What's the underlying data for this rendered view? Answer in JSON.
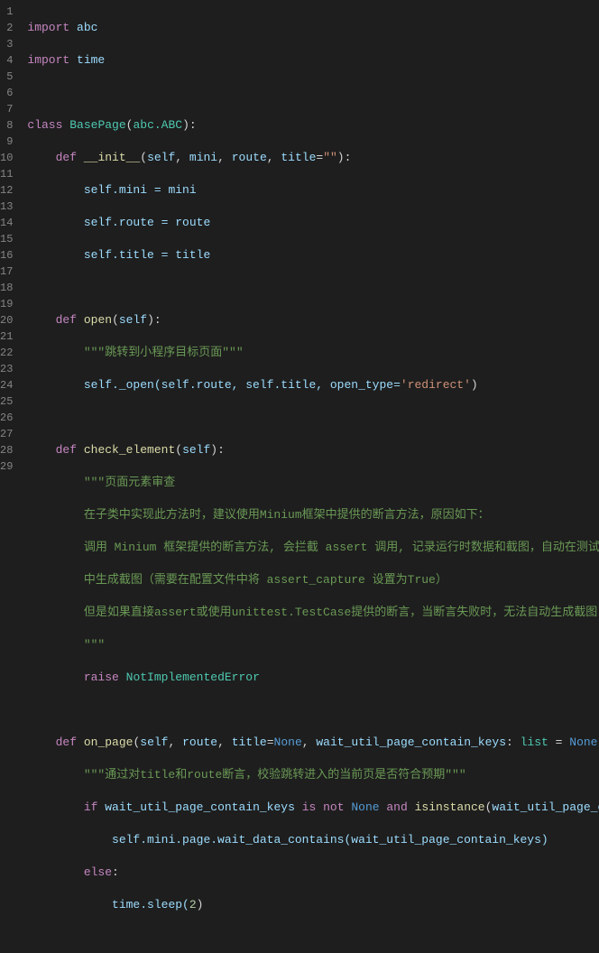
{
  "lines": {
    "l1": {
      "n": "1"
    },
    "l2": {
      "n": "2"
    },
    "l3": {
      "n": "3"
    },
    "l4": {
      "n": "4"
    },
    "l5": {
      "n": "5"
    },
    "l6": {
      "n": "6"
    },
    "l7": {
      "n": "7"
    },
    "l8": {
      "n": "8"
    },
    "l9": {
      "n": "9"
    },
    "l10": {
      "n": "10"
    },
    "l11": {
      "n": "11"
    },
    "l12": {
      "n": "12"
    },
    "l13": {
      "n": "13"
    },
    "l14": {
      "n": "14"
    },
    "l15": {
      "n": "15"
    },
    "l16": {
      "n": "16"
    },
    "l17": {
      "n": "17"
    },
    "l18": {
      "n": "18"
    },
    "l19": {
      "n": "19"
    },
    "l20": {
      "n": "20"
    },
    "l21": {
      "n": "21"
    },
    "l22": {
      "n": "22"
    },
    "l23": {
      "n": "23"
    },
    "l24": {
      "n": "24"
    },
    "l25": {
      "n": "25"
    },
    "l26": {
      "n": "26"
    },
    "l27": {
      "n": "27"
    },
    "l28": {
      "n": "28"
    },
    "l29": {
      "n": "29"
    }
  },
  "t": {
    "import": "import",
    "abc": "abc",
    "time": "time",
    "class": "class",
    "BasePage": "BasePage",
    "lpar": "(",
    "rpar": ")",
    "abcABC": "abc.ABC",
    "colon": ":",
    "def": "def",
    "init": "__init__",
    "self": "self",
    "comma": ", ",
    "mini": "mini",
    "route": "route",
    "title": "title",
    "eq": "=",
    "empty": "\"\"",
    "dot": ".",
    "assign_mini": "self.mini = mini",
    "assign_route": "self.route = route",
    "assign_title": "self.title = title",
    "open": "open",
    "doc_open": "\"\"\"跳转到小程序目标页面\"\"\"",
    "self_open": "self._open(self.route, self.title, open_type=",
    "redirect": "'redirect'",
    "check_element": "check_element",
    "doc_ce_start": "\"\"\"页面元素审查",
    "doc_ce_1": "在子类中实现此方法时，建议使用Minium框架中提供的断言方法，原因如下：",
    "doc_ce_2": "调用 Minium 框架提供的断言方法, 会拦截 assert 调用, 记录运行时数据和截图，自动在测试报告",
    "doc_ce_3": "中生成截图（需要在配置文件中将 assert_capture 设置为True）",
    "doc_ce_4": "但是如果直接assert或使用unittest.TestCase提供的断言，当断言失败时，无法自动生成截图",
    "doc_end": "\"\"\"",
    "raise": "raise",
    "NotImplementedError": "NotImplementedError",
    "on_page": "on_page",
    "None": "None",
    "wkeys": "wait_util_page_contain_keys",
    "list": "list",
    "doc_on_page": "\"\"\"通过对title和route断言，校验跳转进入的当前页是否符合预期\"\"\"",
    "if": "if",
    "is": "is",
    "not": "not",
    "and": "and",
    "isinstance": "isinstance",
    "trail_comma": ",",
    "wait_data": "self.mini.page.wait_data_contains(wait_util_page_contain_keys)",
    "else": "else",
    "sleep": "time.sleep(",
    "two": "2",
    "rpar2": ")"
  }
}
